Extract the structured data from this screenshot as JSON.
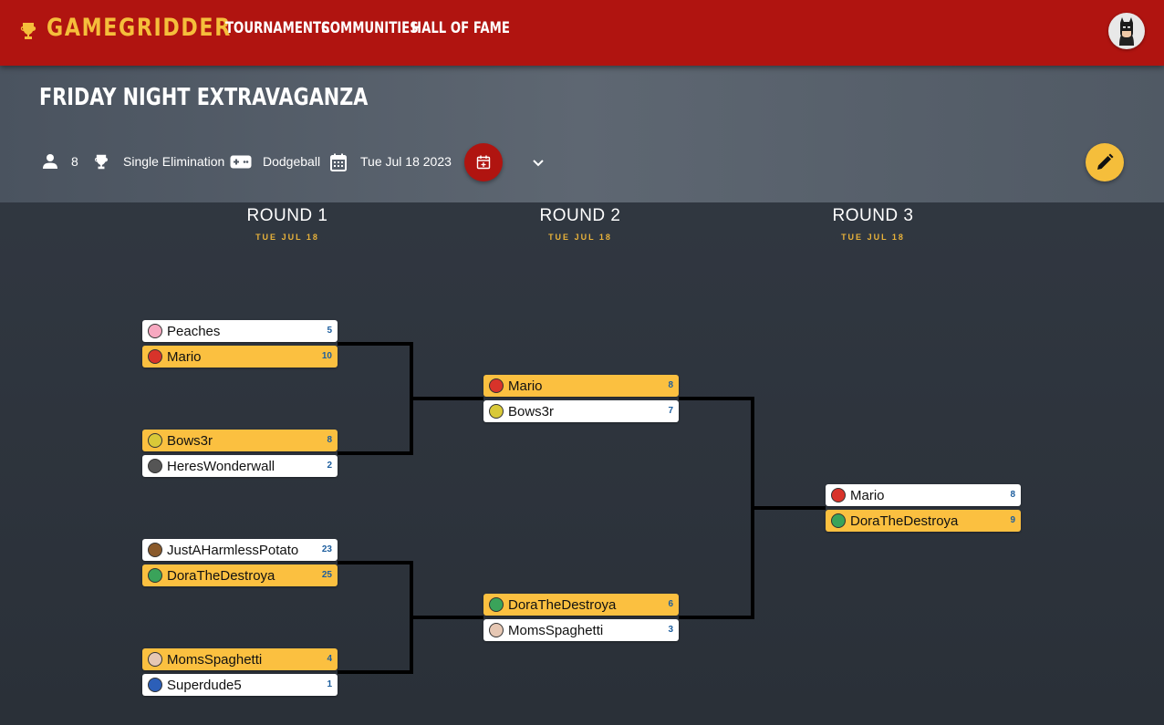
{
  "nav": {
    "brand": "GAMEGRIDDER",
    "links": [
      "TOURNAMENTS",
      "COMMUNITIES",
      "HALL OF FAME"
    ]
  },
  "tournament": {
    "title": "FRIDAY NIGHT EXTRAVAGANZA",
    "players": "8",
    "format": "Single Elimination",
    "game": "Dodgeball",
    "date": "Tue Jul 18 2023"
  },
  "colors": {
    "navbar": "#b01410",
    "accent": "#f5be3b",
    "winner": "#fbc040",
    "score": "#1d5e9e"
  },
  "icons": [
    "trophy-icon",
    "person-icon",
    "gamepad-icon",
    "calendar-icon",
    "calendar-add-icon",
    "chevron-down-icon",
    "pencil-icon"
  ],
  "rounds": [
    {
      "title": "ROUND 1",
      "date": "TUE JUL 18"
    },
    {
      "title": "ROUND 2",
      "date": "TUE JUL 18"
    },
    {
      "title": "ROUND 3",
      "date": "TUE JUL 18"
    }
  ],
  "matches": [
    {
      "players": [
        {
          "name": "Peaches",
          "score": "5",
          "winner": false,
          "avatar": "#f7a8c0"
        },
        {
          "name": "Mario",
          "score": "10",
          "winner": true,
          "avatar": "#d8332a"
        }
      ]
    },
    {
      "players": [
        {
          "name": "Bows3r",
          "score": "8",
          "winner": true,
          "avatar": "#d9c938"
        },
        {
          "name": "HeresWonderwall",
          "score": "2",
          "winner": false,
          "avatar": "#555555"
        }
      ]
    },
    {
      "players": [
        {
          "name": "JustAHarmlessPotato",
          "score": "23",
          "winner": false,
          "avatar": "#8a5a2b"
        },
        {
          "name": "DoraTheDestroya",
          "score": "25",
          "winner": true,
          "avatar": "#3aa35a"
        }
      ]
    },
    {
      "players": [
        {
          "name": "MomsSpaghetti",
          "score": "4",
          "winner": true,
          "avatar": "#e6c7b3"
        },
        {
          "name": "Superdude5",
          "score": "1",
          "winner": false,
          "avatar": "#2c5fb8"
        }
      ]
    },
    {
      "players": [
        {
          "name": "Mario",
          "score": "8",
          "winner": true,
          "avatar": "#d8332a"
        },
        {
          "name": "Bows3r",
          "score": "7",
          "winner": false,
          "avatar": "#d9c938"
        }
      ]
    },
    {
      "players": [
        {
          "name": "DoraTheDestroya",
          "score": "6",
          "winner": true,
          "avatar": "#3aa35a"
        },
        {
          "name": "MomsSpaghetti",
          "score": "3",
          "winner": false,
          "avatar": "#e6c7b3"
        }
      ]
    },
    {
      "players": [
        {
          "name": "Mario",
          "score": "8",
          "winner": false,
          "avatar": "#d8332a"
        },
        {
          "name": "DoraTheDestroya",
          "score": "9",
          "winner": true,
          "avatar": "#3aa35a"
        }
      ]
    }
  ]
}
